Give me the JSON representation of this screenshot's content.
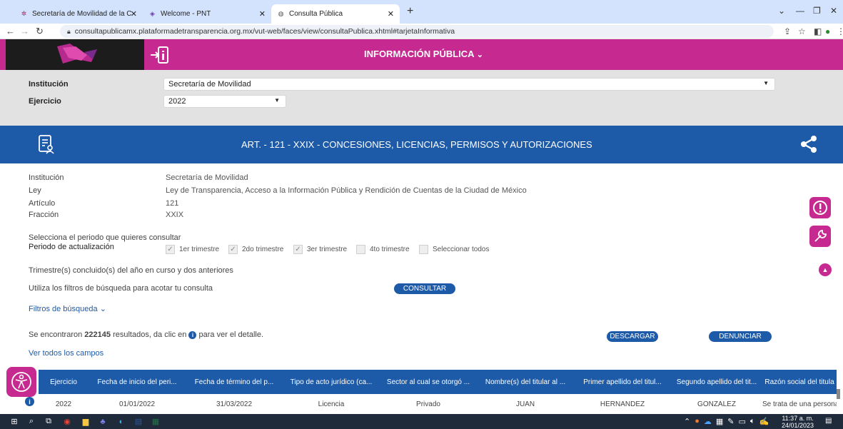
{
  "browser": {
    "tabs": [
      {
        "title": "Secretaría de Movilidad de la CD",
        "active": false
      },
      {
        "title": "Welcome - PNT",
        "active": false
      },
      {
        "title": "Consulta Pública",
        "active": true
      }
    ],
    "url": "consultapublicamx.plataformadetransparencia.org.mx/vut-web/faces/view/consultaPublica.xhtml#tarjetaInformativa"
  },
  "header": {
    "title": "INFORMACIÓN PÚBLICA"
  },
  "filters": {
    "institucion_label": "Institución",
    "institucion_value": "Secretaría de Movilidad",
    "ejercicio_label": "Ejercicio",
    "ejercicio_value": "2022"
  },
  "banner": {
    "title": "ART. - 121 - XXIX - CONCESIONES, LICENCIAS, PERMISOS Y AUTORIZACIONES"
  },
  "details": {
    "institucion_label": "Institución",
    "institucion_value": "Secretaría de Movilidad",
    "ley_label": "Ley",
    "ley_value": "Ley de Transparencia, Acceso a la Información Pública y Rendición de Cuentas de la Ciudad de México",
    "articulo_label": "Artículo",
    "articulo_value": "121",
    "fraccion_label": "Fracción",
    "fraccion_value": "XXIX"
  },
  "period": {
    "prompt": "Selecciona el periodo que quieres consultar",
    "label": "Periodo de actualización",
    "options": [
      {
        "label": "1er trimestre",
        "checked": true
      },
      {
        "label": "2do trimestre",
        "checked": true
      },
      {
        "label": "3er trimestre",
        "checked": true
      },
      {
        "label": "4to trimestre",
        "checked": false
      },
      {
        "label": "Seleccionar todos",
        "checked": false
      }
    ],
    "note": "Trimestre(s) concluido(s) del año en curso y dos anteriores"
  },
  "search": {
    "hint": "Utiliza los filtros de búsqueda para acotar tu consulta",
    "consultar_label": "CONSULTAR",
    "filtros_label": "Filtros de búsqueda"
  },
  "results": {
    "prefix": "Se encontraron",
    "count": "222145",
    "suffix_a": "resultados, da clic en",
    "suffix_b": "para ver el detalle.",
    "descargar_label": "DESCARGAR",
    "denunciar_label": "DENUNCIAR",
    "ver_todos_label": "Ver todos los campos"
  },
  "table": {
    "headers": [
      "Ejercicio",
      "Fecha de inicio del peri...",
      "Fecha de término del p...",
      "Tipo de acto jurídico (ca...",
      "Sector al cual se otorgó ...",
      "Nombre(s) del titular al ...",
      "Primer apellido del titul...",
      "Segundo apellido del tit...",
      "Razón social del titula"
    ],
    "rows": [
      [
        "2022",
        "01/01/2022",
        "31/03/2022",
        "Licencia",
        "Privado",
        "JUAN",
        "HERNANDEZ",
        "GONZALEZ",
        "Se trata de una persona"
      ]
    ]
  },
  "taskbar": {
    "time": "11:37 a. m.",
    "date": "24/01/2023"
  },
  "colors": {
    "magenta": "#c6298f",
    "blue": "#1d5aa8",
    "panel_gray": "#e2e2e2"
  }
}
